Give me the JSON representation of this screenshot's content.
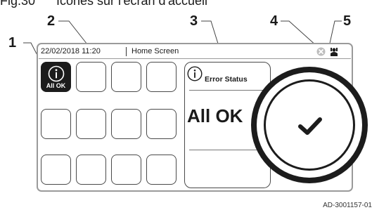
{
  "figure": {
    "caption_number": "Fig.30",
    "caption_text": "Icônes sur l'écran d'accueil",
    "reference": "AD-3001157-01"
  },
  "callouts": [
    "1",
    "2",
    "3",
    "4",
    "5"
  ],
  "status_bar": {
    "datetime": "22/02/2018 11:20",
    "screen_name": "Home Screen",
    "icons": [
      "close-circle-icon",
      "user-icon"
    ]
  },
  "tiles": {
    "rows": 3,
    "cols": 4,
    "first_tile": {
      "icon": "info-icon",
      "label": "All OK",
      "highlighted": true
    }
  },
  "error_panel": {
    "icon": "info-icon",
    "title": "Error Status",
    "state": "All OK"
  },
  "dial": {
    "icon": "checkmark-icon"
  },
  "colors": {
    "dark": "#1c1c1c",
    "frame": "#9a9a9a",
    "tile_border": "#4a4a4a"
  }
}
